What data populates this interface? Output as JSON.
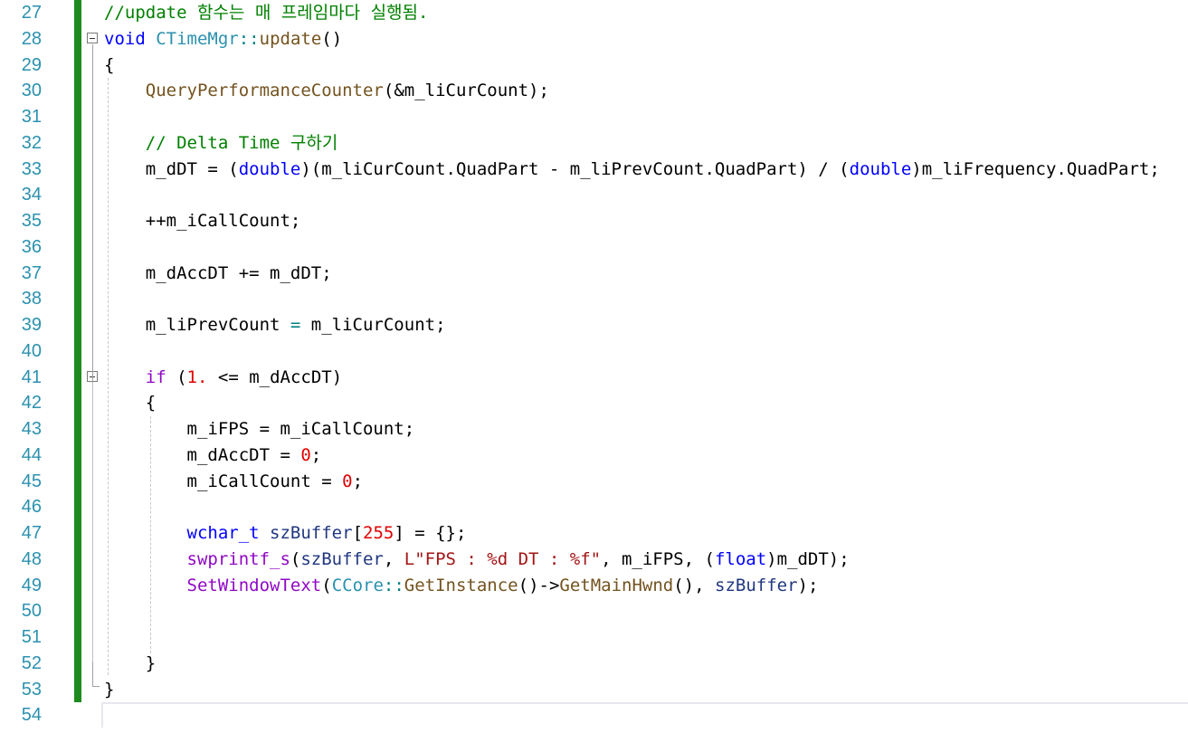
{
  "editor": {
    "lines": [
      {
        "num": "27",
        "tokens": [
          {
            "t": "//update 함수는 매 프레임마다 실행됨.",
            "c": "comment"
          }
        ]
      },
      {
        "num": "28",
        "tokens": [
          {
            "t": "void",
            "c": "keyword"
          },
          {
            "t": " ",
            "c": "plain"
          },
          {
            "t": "CTimeMgr",
            "c": "type"
          },
          {
            "t": "::",
            "c": "op"
          },
          {
            "t": "update",
            "c": "func"
          },
          {
            "t": "()",
            "c": "plain"
          }
        ]
      },
      {
        "num": "29",
        "tokens": [
          {
            "t": "{",
            "c": "plain"
          }
        ]
      },
      {
        "num": "30",
        "tokens": [
          {
            "t": "    ",
            "c": "plain"
          },
          {
            "t": "QueryPerformanceCounter",
            "c": "func"
          },
          {
            "t": "(&m_liCurCount);",
            "c": "plain"
          }
        ]
      },
      {
        "num": "31",
        "tokens": []
      },
      {
        "num": "32",
        "tokens": [
          {
            "t": "    ",
            "c": "plain"
          },
          {
            "t": "// Delta Time 구하기",
            "c": "comment"
          }
        ]
      },
      {
        "num": "33",
        "tokens": [
          {
            "t": "    m_dDT = (",
            "c": "plain"
          },
          {
            "t": "double",
            "c": "keyword"
          },
          {
            "t": ")(m_liCurCount.QuadPart - m_liPrevCount.QuadPart) / (",
            "c": "plain"
          },
          {
            "t": "double",
            "c": "keyword"
          },
          {
            "t": ")m_liFrequency.QuadPart;",
            "c": "plain"
          }
        ]
      },
      {
        "num": "34",
        "tokens": []
      },
      {
        "num": "35",
        "tokens": [
          {
            "t": "    ++m_iCallCount;",
            "c": "plain"
          }
        ]
      },
      {
        "num": "36",
        "tokens": []
      },
      {
        "num": "37",
        "tokens": [
          {
            "t": "    m_dAccDT += m_dDT;",
            "c": "plain"
          }
        ]
      },
      {
        "num": "38",
        "tokens": []
      },
      {
        "num": "39",
        "tokens": [
          {
            "t": "    m_liPrevCount ",
            "c": "plain"
          },
          {
            "t": "=",
            "c": "op"
          },
          {
            "t": " m_liCurCount;",
            "c": "plain"
          }
        ]
      },
      {
        "num": "40",
        "tokens": []
      },
      {
        "num": "41",
        "tokens": [
          {
            "t": "    ",
            "c": "plain"
          },
          {
            "t": "if",
            "c": "macro"
          },
          {
            "t": " (",
            "c": "plain"
          },
          {
            "t": "1.",
            "c": "number"
          },
          {
            "t": " <= m_dAccDT)",
            "c": "plain"
          }
        ]
      },
      {
        "num": "42",
        "tokens": [
          {
            "t": "    {",
            "c": "plain"
          }
        ]
      },
      {
        "num": "43",
        "tokens": [
          {
            "t": "        m_iFPS = m_iCallCount;",
            "c": "plain"
          }
        ]
      },
      {
        "num": "44",
        "tokens": [
          {
            "t": "        m_dAccDT = ",
            "c": "plain"
          },
          {
            "t": "0",
            "c": "number"
          },
          {
            "t": ";",
            "c": "plain"
          }
        ]
      },
      {
        "num": "45",
        "tokens": [
          {
            "t": "        m_iCallCount = ",
            "c": "plain"
          },
          {
            "t": "0",
            "c": "number"
          },
          {
            "t": ";",
            "c": "plain"
          }
        ]
      },
      {
        "num": "46",
        "tokens": []
      },
      {
        "num": "47",
        "tokens": [
          {
            "t": "        ",
            "c": "plain"
          },
          {
            "t": "wchar_t",
            "c": "keyword"
          },
          {
            "t": " ",
            "c": "plain"
          },
          {
            "t": "szBuffer",
            "c": "ident"
          },
          {
            "t": "[",
            "c": "plain"
          },
          {
            "t": "255",
            "c": "number"
          },
          {
            "t": "] = {};",
            "c": "plain"
          }
        ]
      },
      {
        "num": "48",
        "tokens": [
          {
            "t": "        ",
            "c": "plain"
          },
          {
            "t": "swprintf_s",
            "c": "macro"
          },
          {
            "t": "(",
            "c": "plain"
          },
          {
            "t": "szBuffer",
            "c": "ident"
          },
          {
            "t": ", ",
            "c": "plain"
          },
          {
            "t": "L\"FPS : %d DT : %f\"",
            "c": "string"
          },
          {
            "t": ", m_iFPS, (",
            "c": "plain"
          },
          {
            "t": "float",
            "c": "keyword"
          },
          {
            "t": ")m_dDT);",
            "c": "plain"
          }
        ]
      },
      {
        "num": "49",
        "tokens": [
          {
            "t": "        ",
            "c": "plain"
          },
          {
            "t": "SetWindowText",
            "c": "macro"
          },
          {
            "t": "(",
            "c": "plain"
          },
          {
            "t": "CCore",
            "c": "type"
          },
          {
            "t": "::",
            "c": "op"
          },
          {
            "t": "GetInstance",
            "c": "func"
          },
          {
            "t": "()->",
            "c": "plain"
          },
          {
            "t": "GetMainHwnd",
            "c": "func"
          },
          {
            "t": "(), ",
            "c": "plain"
          },
          {
            "t": "szBuffer",
            "c": "ident"
          },
          {
            "t": ");",
            "c": "plain"
          }
        ]
      },
      {
        "num": "50",
        "tokens": []
      },
      {
        "num": "51",
        "tokens": []
      },
      {
        "num": "52",
        "tokens": [
          {
            "t": "    }",
            "c": "plain"
          }
        ]
      },
      {
        "num": "53",
        "tokens": [
          {
            "t": "}",
            "c": "plain"
          }
        ]
      },
      {
        "num": "54",
        "tokens": []
      }
    ]
  },
  "colors": {
    "comment": "#008000",
    "keyword": "#0000ff",
    "type": "#2b91af",
    "line_number": "#2b91af",
    "change_bar": "#1e8a1e"
  }
}
